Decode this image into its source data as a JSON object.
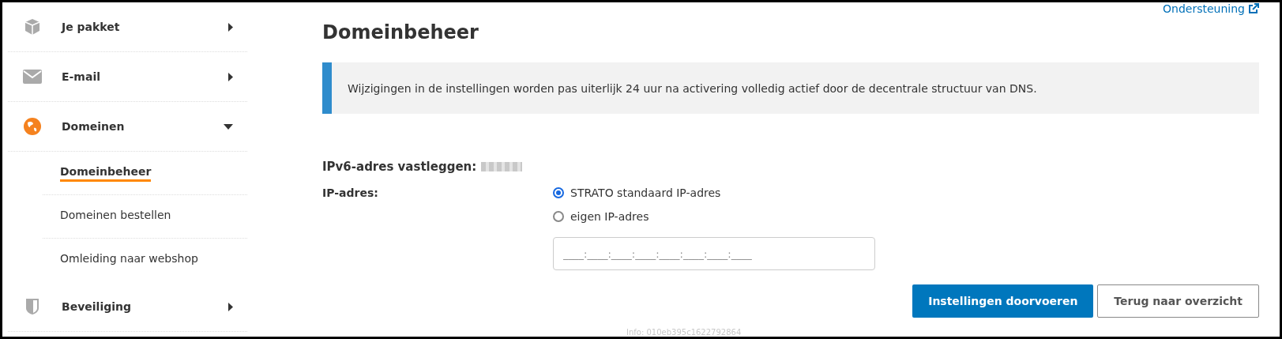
{
  "sidebar": {
    "items": [
      {
        "label": "Je pakket",
        "expanded": false
      },
      {
        "label": "E-mail",
        "expanded": false
      },
      {
        "label": "Domeinen",
        "expanded": true,
        "children": [
          {
            "label": "Domeinbeheer",
            "selected": true
          },
          {
            "label": "Domeinen bestellen",
            "selected": false
          },
          {
            "label": "Omleiding naar webshop",
            "selected": false
          }
        ]
      },
      {
        "label": "Beveiliging",
        "expanded": false
      }
    ]
  },
  "support_link": "Ondersteuning",
  "title": "Domeinbeheer",
  "notice": "Wijzigingen in de instellingen worden pas uiterlijk 24 uur na activering volledig actief door de decentrale structuur van DNS.",
  "form": {
    "heading": "IPv6-adres vastleggen:",
    "field_label": "IP-adres:",
    "options": [
      {
        "label": "STRATO standaard IP-adres",
        "selected": true
      },
      {
        "label": "eigen IP-adres",
        "selected": false
      }
    ],
    "ip_placeholder": "____:____:____:____:____:____:____:____"
  },
  "buttons": [
    {
      "label": "Instellingen doorvoeren",
      "kind": "primary"
    },
    {
      "label": "Terug naar overzicht",
      "kind": "secondary"
    }
  ],
  "footer_info": "Info: 010eb395c1622792864"
}
